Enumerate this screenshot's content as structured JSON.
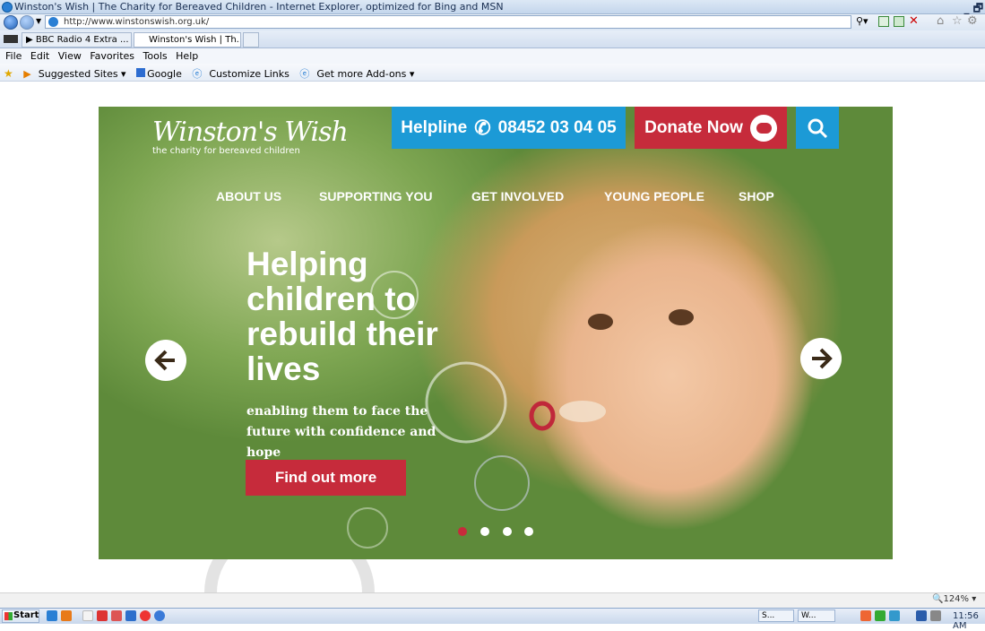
{
  "window": {
    "title": "Winston's Wish | The Charity for Bereaved Children - Internet Explorer, optimized for Bing and MSN",
    "controls": "_ 🗗"
  },
  "address": {
    "url": "http://www.winstonswish.org.uk/"
  },
  "tabs": [
    {
      "label": "▶ BBC Radio 4 Extra ..."
    },
    {
      "label": "Winston's Wish | Th...  ×"
    }
  ],
  "menu": [
    "File",
    "Edit",
    "View",
    "Favorites",
    "Tools",
    "Help"
  ],
  "favorites": [
    "Suggested Sites ▾",
    "Google",
    "Customize Links",
    "Get more Add-ons ▾"
  ],
  "site": {
    "logo_name": "Winston's Wish",
    "logo_tagline": "the charity for bereaved children",
    "helpline_label": "Helpline",
    "helpline_number": "08452 03 04 05",
    "donate_label": "Donate Now",
    "nav": [
      "ABOUT US",
      "SUPPORTING YOU",
      "GET INVOLVED",
      "YOUNG PEOPLE",
      "SHOP"
    ],
    "headline": "Helping children to rebuild their lives",
    "subline": "enabling them to face the future with confidence and hope",
    "cta_label": "Find out more",
    "carousel": {
      "slides": 4,
      "active": 1
    }
  },
  "status": {
    "zoom": "124%"
  },
  "taskbar": {
    "start": "Start",
    "item1": "S...",
    "item2": "W...",
    "clock": "11:56 AM"
  },
  "colors": {
    "brand_blue": "#1c9ad6",
    "brand_red": "#c62b3b"
  }
}
